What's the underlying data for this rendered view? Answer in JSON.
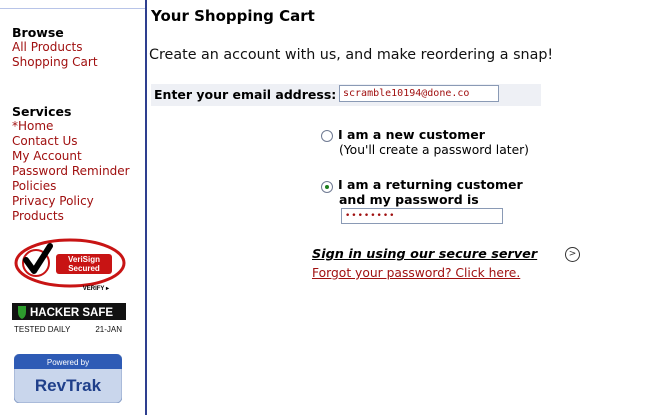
{
  "sidebar": {
    "browse_heading": "Browse",
    "browse_items": [
      "All Products",
      "Shopping Cart"
    ],
    "services_heading": "Services",
    "services_items": [
      "*Home",
      "Contact Us",
      "My Account",
      "Password Reminder",
      "Policies",
      "Privacy Policy",
      "Products"
    ],
    "badges": {
      "verisign_line1": "VeriSign",
      "verisign_line2": "Secured",
      "verisign_verify": "VERIFY ▸",
      "hacker_safe": "HACKER SAFE",
      "hacker_tested": "TESTED DAILY",
      "hacker_date": "21-JAN",
      "powered_by": "Powered by",
      "revtrak": "RevTrak"
    }
  },
  "main": {
    "title": "Your Shopping Cart",
    "intro": "Create an account with us, and make reordering a snap!",
    "email_label": "Enter your email address:",
    "email_value": "scramble10194@done.co",
    "option_new_label": "I am a new customer",
    "option_new_sub": "(You'll create a password later)",
    "option_returning_line1": "I am a returning customer",
    "option_returning_line2": "and my password is",
    "password_value": "••••••••",
    "selected_option": "returning",
    "signin_label": "Sign in using our secure server",
    "forgot_label": "Forgot your password? Click here."
  },
  "colors": {
    "link": "#a01010",
    "divider": "#2e3f8f",
    "radio_selected": "#1c7d1c"
  }
}
